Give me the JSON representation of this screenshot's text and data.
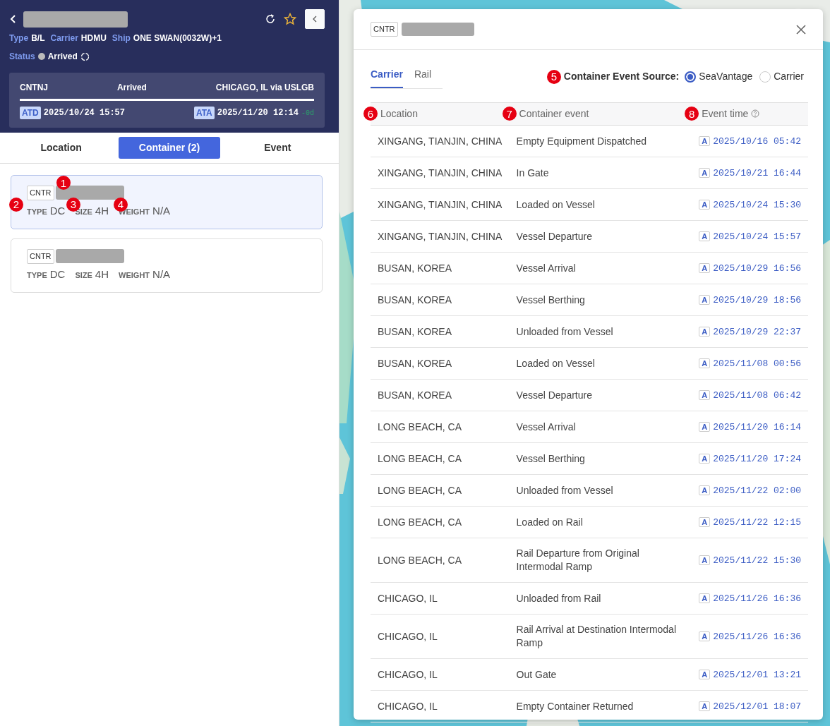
{
  "header": {
    "fields": [
      {
        "label": "Type",
        "value": "B/L"
      },
      {
        "label": "Carrier",
        "value": "HDMU"
      },
      {
        "label": "Ship",
        "value": "ONE SWAN(0032W)+1"
      }
    ],
    "status": {
      "label": "Status",
      "value": "Arrived"
    },
    "route": {
      "origin": "CNTNJ",
      "state": "Arrived",
      "destination": "CHICAGO, IL via USLGB",
      "departure": {
        "tag": "ATD",
        "time": "2025/10/24 15:57"
      },
      "arrival": {
        "tag": "ATA",
        "time": "2025/11/20 12:14",
        "delay": "-0d"
      }
    }
  },
  "tabs": [
    {
      "label": "Location",
      "selected": false
    },
    {
      "label": "Container (2)",
      "selected": true
    },
    {
      "label": "Event",
      "selected": false
    }
  ],
  "containers": [
    {
      "tag": "CNTR",
      "marker": "1",
      "selected": true,
      "fields": [
        {
          "label": "TYPE",
          "value": "DC",
          "marker": "2"
        },
        {
          "label": "SIZE",
          "value": "4H",
          "marker": "3"
        },
        {
          "label": "WEIGHT",
          "value": "N/A",
          "marker": "4"
        }
      ]
    },
    {
      "tag": "CNTR",
      "selected": false,
      "fields": [
        {
          "label": "TYPE",
          "value": "DC"
        },
        {
          "label": "SIZE",
          "value": "4H"
        },
        {
          "label": "WEIGHT",
          "value": "N/A"
        }
      ]
    }
  ],
  "modal": {
    "tag": "CNTR",
    "tabs": [
      {
        "label": "Carrier",
        "selected": true
      },
      {
        "label": "Rail",
        "selected": false
      }
    ],
    "source": {
      "label": "Container Event Source:",
      "marker": "5",
      "options": [
        {
          "label": "SeaVantage",
          "selected": true
        },
        {
          "label": "Carrier",
          "selected": false
        }
      ]
    },
    "table": {
      "columns": [
        {
          "label": "Location",
          "marker": "6"
        },
        {
          "label": "Container event",
          "marker": "7"
        },
        {
          "label": "Event time",
          "marker": "8"
        }
      ],
      "rows": [
        {
          "location": "XINGANG, TIANJIN, CHINA",
          "event": "Empty Equipment Dispatched",
          "badge": "A",
          "time": "2025/10/16 05:42"
        },
        {
          "location": "XINGANG, TIANJIN, CHINA",
          "event": "In Gate",
          "badge": "A",
          "time": "2025/10/21 16:44"
        },
        {
          "location": "XINGANG, TIANJIN, CHINA",
          "event": "Loaded on Vessel",
          "badge": "A",
          "time": "2025/10/24 15:30"
        },
        {
          "location": "XINGANG, TIANJIN, CHINA",
          "event": "Vessel Departure",
          "badge": "A",
          "time": "2025/10/24 15:57"
        },
        {
          "location": "BUSAN, KOREA",
          "event": "Vessel Arrival",
          "badge": "A",
          "time": "2025/10/29 16:56"
        },
        {
          "location": "BUSAN, KOREA",
          "event": "Vessel Berthing",
          "badge": "A",
          "time": "2025/10/29 18:56"
        },
        {
          "location": "BUSAN, KOREA",
          "event": "Unloaded from Vessel",
          "badge": "A",
          "time": "2025/10/29 22:37"
        },
        {
          "location": "BUSAN, KOREA",
          "event": "Loaded on Vessel",
          "badge": "A",
          "time": "2025/11/08 00:56"
        },
        {
          "location": "BUSAN, KOREA",
          "event": "Vessel Departure",
          "badge": "A",
          "time": "2025/11/08 06:42"
        },
        {
          "location": "LONG BEACH, CA",
          "event": "Vessel Arrival",
          "badge": "A",
          "time": "2025/11/20 16:14"
        },
        {
          "location": "LONG BEACH, CA",
          "event": "Vessel Berthing",
          "badge": "A",
          "time": "2025/11/20 17:24"
        },
        {
          "location": "LONG BEACH, CA",
          "event": "Unloaded from Vessel",
          "badge": "A",
          "time": "2025/11/22 02:00"
        },
        {
          "location": "LONG BEACH, CA",
          "event": "Loaded on Rail",
          "badge": "A",
          "time": "2025/11/22 12:15"
        },
        {
          "location": "LONG BEACH, CA",
          "event": "Rail Departure from Original Intermodal Ramp",
          "badge": "A",
          "time": "2025/11/22 15:30"
        },
        {
          "location": "CHICAGO, IL",
          "event": "Unloaded from Rail",
          "badge": "A",
          "time": "2025/11/26 16:36"
        },
        {
          "location": "CHICAGO, IL",
          "event": "Rail Arrival at Destination Intermodal Ramp",
          "badge": "A",
          "time": "2025/11/26 16:36"
        },
        {
          "location": "CHICAGO, IL",
          "event": "Out Gate",
          "badge": "A",
          "time": "2025/12/01 13:21"
        },
        {
          "location": "CHICAGO, IL",
          "event": "Empty Container Returned",
          "badge": "A",
          "time": "2025/12/01 18:07"
        }
      ]
    }
  }
}
